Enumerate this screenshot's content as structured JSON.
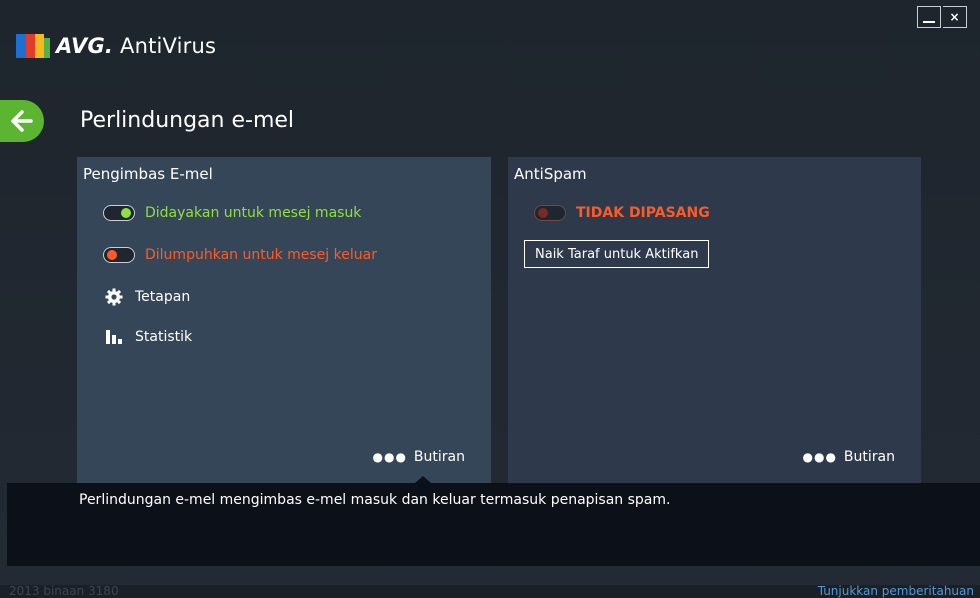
{
  "app": {
    "brand_bold": "AVG.",
    "brand_name": "AntiVirus",
    "page_title": "Perlindungan e-mel"
  },
  "window": {
    "minimize_icon": "minimize-icon",
    "close_icon": "close-icon",
    "close_label": "×"
  },
  "email_scanner": {
    "title": "Pengimbas E-mel",
    "incoming": {
      "label": "Didayakan untuk mesej masuk",
      "state": "on",
      "color": "#8fe03c"
    },
    "outgoing": {
      "label": "Dilumpuhkan untuk mesej keluar",
      "state": "off",
      "color": "#ff5a25"
    },
    "settings_label": "Tetapan",
    "stats_label": "Statistik",
    "details_label": "Butiran"
  },
  "antispam": {
    "title": "AntiSpam",
    "status_label": "TIDAK DIPASANG",
    "status_color": "#ff5a25",
    "upgrade_label": "Naik Taraf untuk Aktifkan",
    "details_label": "Butiran"
  },
  "description": "Perlindungan e-mel mengimbas e-mel masuk dan keluar termasuk penapisan spam.",
  "footer": {
    "build": "2013  binaan 3180",
    "notifications_link": "Tunjukkan pemberitahuan"
  },
  "colors": {
    "accent_green": "#5cb531",
    "panel_active": "#364659",
    "panel_inactive": "#2e3a4b"
  }
}
